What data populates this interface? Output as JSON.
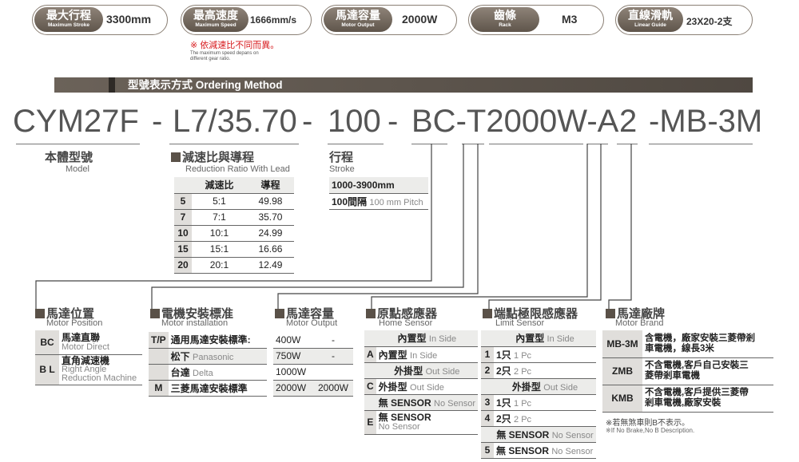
{
  "specs": [
    {
      "zh": "最大行程",
      "en": "Maximum Stroke",
      "value": "3300mm"
    },
    {
      "zh": "最高速度",
      "en": "Maximum Speed",
      "value": "1666mm/s"
    },
    {
      "zh": "馬達容量",
      "en": "Motor Output",
      "value": "2000W"
    },
    {
      "zh": "齒條",
      "en": "Rack",
      "value": "M3"
    },
    {
      "zh": "直線滑軌",
      "en": "Linear Guide",
      "value": "23X20-2支"
    }
  ],
  "speed_note": {
    "zh": "※ 依減速比不同而異。",
    "en_1": "The maximum speed depans on",
    "en_2": "different gear ratio."
  },
  "ordering": {
    "title": "型號表示方式 Ordering Method"
  },
  "code": {
    "model": "CYM27F",
    "dash1": "-",
    "ratio": "L7/35.70",
    "dash2": "-",
    "stroke": "100",
    "dash3": "-",
    "rest": "BC-T2000W-A",
    "limit": "2",
    "brand": "-MB-3M"
  },
  "model_block": {
    "zh": "本體型號",
    "en": "Model"
  },
  "reduction": {
    "zh": "減速比與導程",
    "en": "Reduction Ratio With  Lead",
    "headers": [
      "減速比",
      "導程"
    ],
    "rows": [
      {
        "code": "5",
        "ratio": "5:1",
        "lead": "49.98"
      },
      {
        "code": "7",
        "ratio": "7:1",
        "lead": "35.70"
      },
      {
        "code": "10",
        "ratio": "10:1",
        "lead": "24.99"
      },
      {
        "code": "15",
        "ratio": "15:1",
        "lead": "16.66"
      },
      {
        "code": "20",
        "ratio": "20:1",
        "lead": "12.49"
      }
    ]
  },
  "stroke_block": {
    "zh": "行程",
    "en": "Stroke",
    "range": "1000-3900mm",
    "pitch_zh": "100間隔",
    "pitch_en": "100 mm Pitch"
  },
  "motor_position": {
    "zh": "馬達位置",
    "en": "Motor Position",
    "rows": [
      {
        "code": "BC",
        "zh": "馬達直聯",
        "en": "Motor Direct"
      },
      {
        "code": "B L",
        "zh": "直角減速機",
        "en_1": "Right Angle",
        "en_2": "Reduction Machine"
      }
    ]
  },
  "motor_install": {
    "zh": "電機安裝標准",
    "en": "Motor installation",
    "tp_code": "T/P",
    "tp_label": "通用馬達安裝標準:",
    "panasonic_zh": "松下",
    "panasonic_en": "Panasonic",
    "delta_zh": "台達",
    "delta_en": "Delta",
    "m_code": "M",
    "m_label": "三菱馬達安裝標準"
  },
  "motor_output": {
    "zh": "馬達容量",
    "en": "Motor Output",
    "rows": [
      {
        "a": "400W",
        "b": "-"
      },
      {
        "a": "750W",
        "b": "-"
      },
      {
        "a": "1000W",
        "b": ""
      },
      {
        "a": "2000W",
        "b": "2000W"
      }
    ]
  },
  "home_sensor": {
    "zh": "原點感應器",
    "en": "Home Sensor",
    "inside_head_zh": "內置型",
    "inside_head_en": "In Side",
    "a_code": "A",
    "a_zh": "內置型",
    "a_en": "In Side",
    "outside_head_zh": "外掛型",
    "outside_head_en": "Out Side",
    "c_code": "C",
    "c_zh": "外掛型",
    "c_en": "Out Side",
    "none_zh": "無 SENSOR",
    "none_en": "No Sensor",
    "e_code": "E",
    "e_zh": "無 SENSOR",
    "e_en": "No Sensor"
  },
  "limit_sensor": {
    "zh": "端點極限感應器",
    "en": "Limit Sensor",
    "inside_head_zh": "內置型",
    "inside_head_en": "In Side",
    "r1": {
      "code": "1",
      "zh": "1只",
      "en": "1 Pc"
    },
    "r2": {
      "code": "2",
      "zh": "2只",
      "en": "2 Pc"
    },
    "outside_head_zh": "外掛型",
    "outside_head_en": "Out Side",
    "r3": {
      "code": "3",
      "zh": "1只",
      "en": "1 Pc"
    },
    "r4": {
      "code": "4",
      "zh": "2只",
      "en": "2 Pc"
    },
    "none_zh": "無 SENSOR",
    "none_en": "No Sensor",
    "r5": {
      "code": "5",
      "zh": "無 SENSOR",
      "en": "No Sensor"
    }
  },
  "motor_brand": {
    "zh": "馬達廠牌",
    "en": "Motor Brand",
    "rows": [
      {
        "code": "MB-3M",
        "l1": "含電機，廠家安裝三菱帶剎",
        "l2": "車電機，線長3米"
      },
      {
        "code": "ZMB",
        "l1": "不含電機,客戶自己安裝三",
        "l2": "菱帶剎車電機"
      },
      {
        "code": "KMB",
        "l1": "不含電機,客戶提供三菱帶",
        "l2": "剎車電機,廠家安裝"
      }
    ],
    "note_zh": "※若無煞車則B不表示。",
    "note_en": "※If No Brake,No B Description."
  }
}
